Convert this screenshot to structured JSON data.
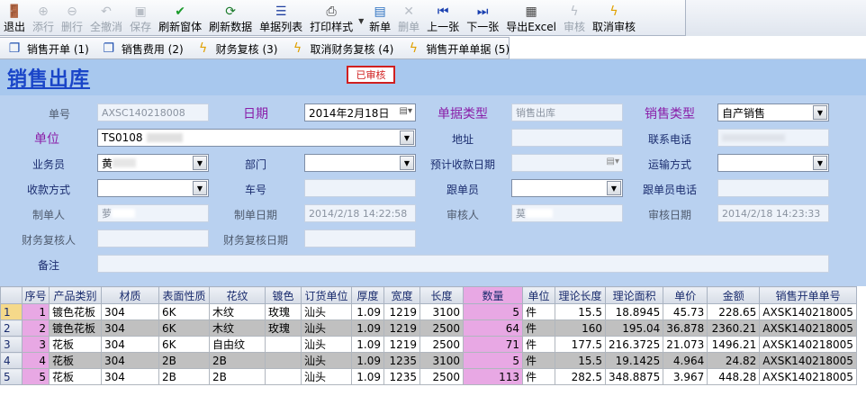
{
  "toolbar": {
    "buttons": [
      {
        "label": "退出",
        "icon": "exit-icon",
        "disabled": false
      },
      {
        "label": "添行",
        "icon": "add-row-icon",
        "disabled": true
      },
      {
        "label": "删行",
        "icon": "delete-row-icon",
        "disabled": true
      },
      {
        "label": "全撤消",
        "icon": "undo-icon",
        "disabled": true
      },
      {
        "label": "保存",
        "icon": "save-icon",
        "disabled": true
      },
      {
        "label": "刷新窗体",
        "icon": "check-icon",
        "disabled": false
      },
      {
        "label": "刷新数据",
        "icon": "refresh-icon",
        "disabled": false
      },
      {
        "label": "单据列表",
        "icon": "list-icon",
        "disabled": false
      },
      {
        "label": "打印样式",
        "icon": "printer-icon",
        "disabled": false
      },
      {
        "label": "新单",
        "icon": "new-doc-icon",
        "disabled": false
      },
      {
        "label": "删单",
        "icon": "delete-icon",
        "disabled": true
      },
      {
        "label": "上一张",
        "icon": "prev-icon",
        "disabled": false
      },
      {
        "label": "下一张",
        "icon": "next-icon",
        "disabled": false
      },
      {
        "label": "导出Excel",
        "icon": "excel-icon",
        "disabled": false
      },
      {
        "label": "审核",
        "icon": "lightning-icon",
        "disabled": true
      },
      {
        "label": "取消审核",
        "icon": "lightning-icon",
        "disabled": false
      }
    ]
  },
  "tabs": [
    {
      "label": "销售开单 (1)",
      "icon": "window-icon"
    },
    {
      "label": "销售费用 (2)",
      "icon": "window-icon"
    },
    {
      "label": "财务复核 (3)",
      "icon": "lightning-icon"
    },
    {
      "label": "取消财务复核 (4)",
      "icon": "lightning-icon"
    },
    {
      "label": "销售开单单据 (5)",
      "icon": "lightning-icon"
    }
  ],
  "header": {
    "title": "销售出库",
    "status": "已审核"
  },
  "form": {
    "order_no_label": "单号",
    "order_no": "AXSC140218008",
    "date_label": "日期",
    "date": "2014年2月18日",
    "doc_type_label": "单据类型",
    "doc_type": "销售出库",
    "sale_type_label": "销售类型",
    "sale_type": "自产销售",
    "unit_label": "单位",
    "unit": "TS0108 ",
    "address_label": "地址",
    "address": "",
    "phone_label": "联系电话",
    "phone": "",
    "salesman_label": "业务员",
    "salesman": "黄",
    "dept_label": "部门",
    "dept": "",
    "expected_date_label": "预计收款日期",
    "expected_date": "",
    "shipping_label": "运输方式",
    "shipping": "",
    "payment_label": "收款方式",
    "payment": "",
    "vehicle_label": "车号",
    "vehicle": "",
    "follower_label": "跟单员",
    "follower": "",
    "follower_phone_label": "跟单员电话",
    "follower_phone": "",
    "creator_label": "制单人",
    "creator": "萝",
    "created_date_label": "制单日期",
    "created_date": "2014/2/18 14:22:58",
    "reviewer_label": "审核人",
    "reviewer": "莫",
    "reviewed_date_label": "审核日期",
    "reviewed_date": "2014/2/18 14:23:33",
    "finance_reviewer_label": "财务复核人",
    "finance_reviewer": "",
    "finance_review_date_label": "财务复核日期",
    "finance_review_date": "",
    "remark_label": "备注",
    "remark": ""
  },
  "grid": {
    "columns": [
      "序号",
      "产品类别",
      "材质",
      "表面性质",
      "花纹",
      "镀色",
      "订货单位",
      "厚度",
      "宽度",
      "长度",
      "数量",
      "单位",
      "理论长度",
      "理论面积",
      "单价",
      "金额",
      "销售开单单号"
    ],
    "rows": [
      [
        "1",
        "1",
        "镀色花板",
        "304",
        "6K",
        "木纹",
        "玫瑰",
        "汕头",
        "1.09",
        "1219",
        "3100",
        "5",
        "件",
        "15.5",
        "18.8945",
        "45.73",
        "228.65",
        "AXSK140218005"
      ],
      [
        "2",
        "2",
        "镀色花板",
        "304",
        "6K",
        "木纹",
        "玫瑰",
        "汕头",
        "1.09",
        "1219",
        "2500",
        "64",
        "件",
        "160",
        "195.04",
        "36.878",
        "2360.21",
        "AXSK140218005"
      ],
      [
        "3",
        "3",
        "花板",
        "304",
        "6K",
        "自由纹",
        "",
        "汕头",
        "1.09",
        "1219",
        "2500",
        "71",
        "件",
        "177.5",
        "216.3725",
        "21.073",
        "1496.21",
        "AXSK140218005"
      ],
      [
        "4",
        "4",
        "花板",
        "304",
        "2B",
        "2B",
        "",
        "汕头",
        "1.09",
        "1235",
        "3100",
        "5",
        "件",
        "15.5",
        "19.1425",
        "4.964",
        "24.82",
        "AXSK140218005"
      ],
      [
        "5",
        "5",
        "花板",
        "304",
        "2B",
        "2B",
        "",
        "汕头",
        "1.09",
        "1235",
        "2500",
        "113",
        "件",
        "282.5",
        "348.8875",
        "3.967",
        "448.28",
        "AXSK140218005"
      ]
    ]
  }
}
